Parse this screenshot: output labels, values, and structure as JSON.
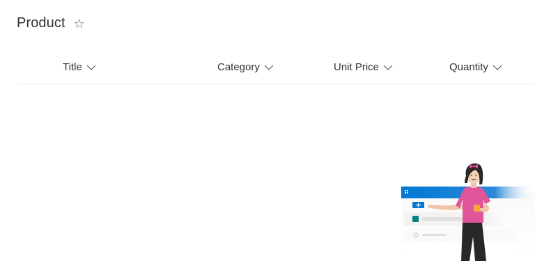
{
  "list": {
    "title": "Product",
    "favorite_icon": "star-outline-icon"
  },
  "columns": [
    {
      "label": "Title",
      "icon": "chevron-down-icon"
    },
    {
      "label": "Category",
      "icon": "chevron-down-icon"
    },
    {
      "label": "Unit Price",
      "icon": "chevron-down-icon"
    },
    {
      "label": "Quantity",
      "icon": "chevron-down-icon"
    }
  ],
  "colors": {
    "accent": "#0078d4",
    "text": "#323130",
    "divider": "#edebe9",
    "character_shirt": "#e0559a"
  }
}
